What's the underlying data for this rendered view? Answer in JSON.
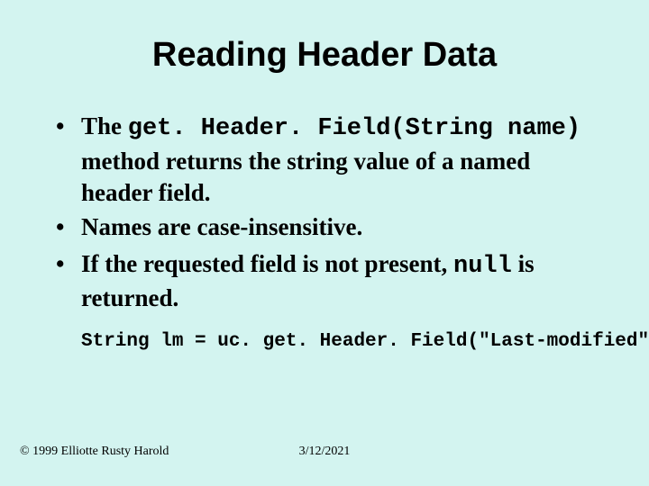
{
  "title": "Reading Header Data",
  "bullets": [
    {
      "pre": "The ",
      "code": "get. Header. Field(String name)",
      "post": " method returns the string value of a named header field."
    },
    {
      "pre": "Names are case-insensitive.",
      "code": "",
      "post": ""
    },
    {
      "pre": "If the requested field is not present, ",
      "code": "null",
      "post": " is returned."
    }
  ],
  "code_line": "String lm = uc. get. Header. Field(\"Last-modified\");",
  "footer": {
    "copyright": "© 1999 Elliotte Rusty Harold",
    "date": "3/12/2021"
  }
}
